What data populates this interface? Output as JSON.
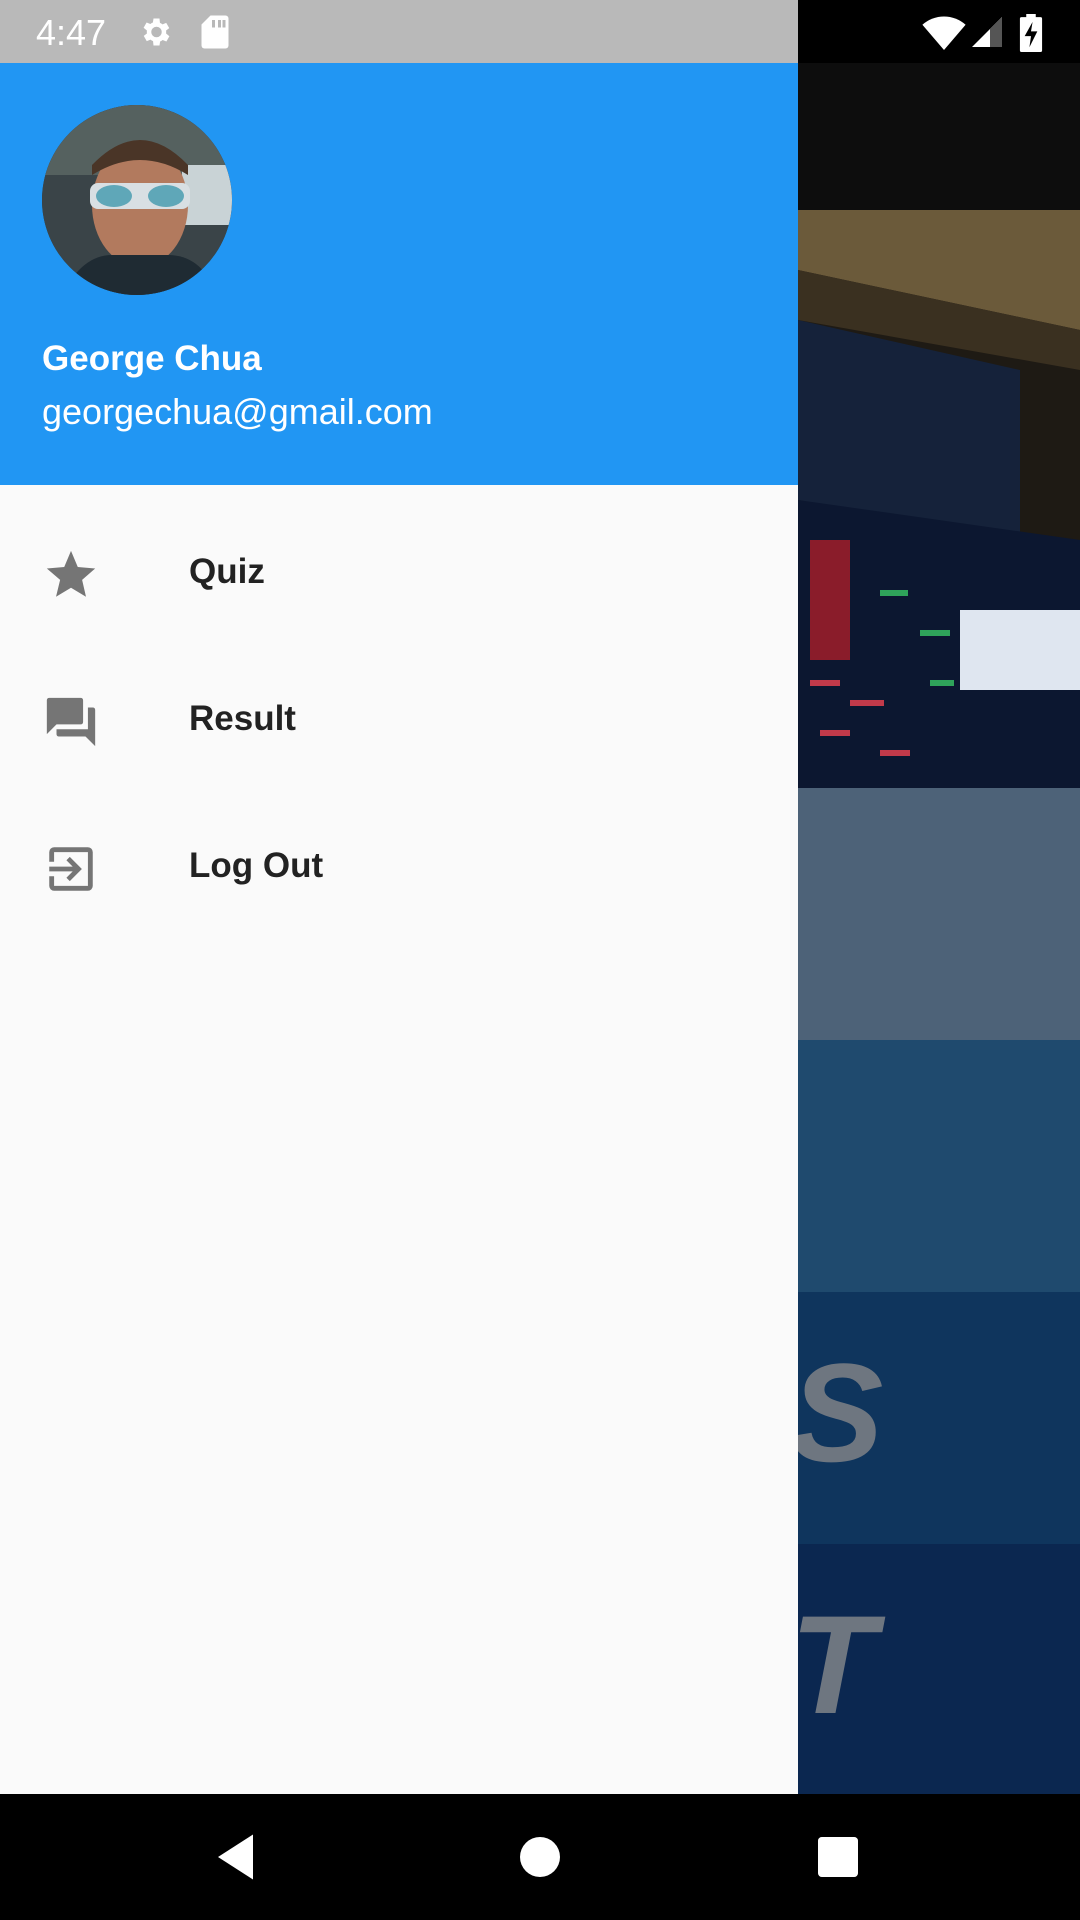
{
  "status_bar": {
    "time": "4:47",
    "icons_left": [
      "gear-icon",
      "sd-card-icon"
    ],
    "icons_right": [
      "wifi-icon",
      "signal-icon",
      "battery-charging-icon"
    ]
  },
  "drawer": {
    "header": {
      "name": "George Chua",
      "email": "georgechua@gmail.com",
      "background_color": "#2196f3"
    },
    "items": [
      {
        "label": "Quiz",
        "icon": "star-icon"
      },
      {
        "label": "Result",
        "icon": "forum-icon"
      },
      {
        "label": "Log Out",
        "icon": "exit-icon"
      }
    ]
  },
  "background": {
    "band_glyphs": [
      "S",
      "T"
    ]
  },
  "nav_bar": {
    "buttons": [
      "back-icon",
      "home-icon",
      "recents-icon"
    ]
  }
}
